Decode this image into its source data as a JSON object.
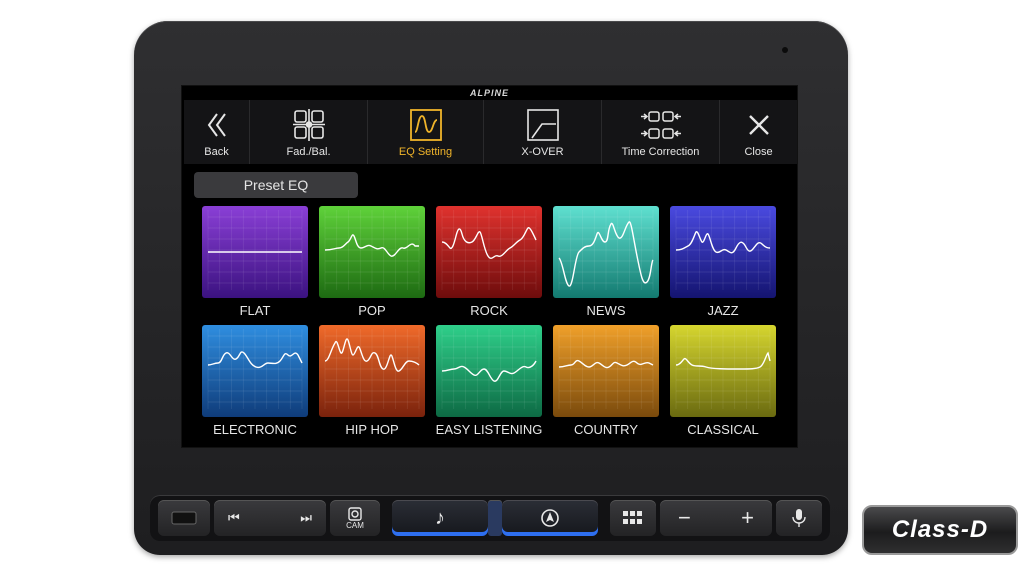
{
  "brand": "ALPINE",
  "topbar": {
    "items": [
      {
        "label": "Back",
        "icon": "back-icon"
      },
      {
        "label": "Fad./Bal.",
        "icon": "seats-icon"
      },
      {
        "label": "EQ Setting",
        "icon": "eq-wave-icon",
        "active": true
      },
      {
        "label": "X-OVER",
        "icon": "crossover-icon"
      },
      {
        "label": "Time Correction",
        "icon": "time-correction-icon"
      },
      {
        "label": "Close",
        "icon": "close-icon"
      }
    ]
  },
  "preset_label": "Preset EQ",
  "presets": [
    {
      "label": "FLAT",
      "color_top": "#8a3fd6",
      "color_bottom": "#3b1280"
    },
    {
      "label": "POP",
      "color_top": "#5fd23a",
      "color_bottom": "#1d6a12"
    },
    {
      "label": "ROCK",
      "color_top": "#e0322e",
      "color_bottom": "#6e0c0c"
    },
    {
      "label": "NEWS",
      "color_top": "#5fe0d0",
      "color_bottom": "#137a70"
    },
    {
      "label": "JAZZ",
      "color_top": "#4a4ae0",
      "color_bottom": "#141470"
    },
    {
      "label": "ELECTRONIC",
      "color_top": "#2f8ee0",
      "color_bottom": "#0f3c7a"
    },
    {
      "label": "HIP HOP",
      "color_top": "#f06a2a",
      "color_bottom": "#7a220c"
    },
    {
      "label": "EASY LISTENING",
      "color_top": "#2fcf8a",
      "color_bottom": "#0d6a44"
    },
    {
      "label": "COUNTRY",
      "color_top": "#f0a02a",
      "color_bottom": "#7a4a0c"
    },
    {
      "label": "CLASSICAL",
      "color_top": "#d6d62f",
      "color_bottom": "#6a6a10"
    }
  ],
  "controls": {
    "cam_label": "CAM"
  },
  "badge": "Class-D"
}
